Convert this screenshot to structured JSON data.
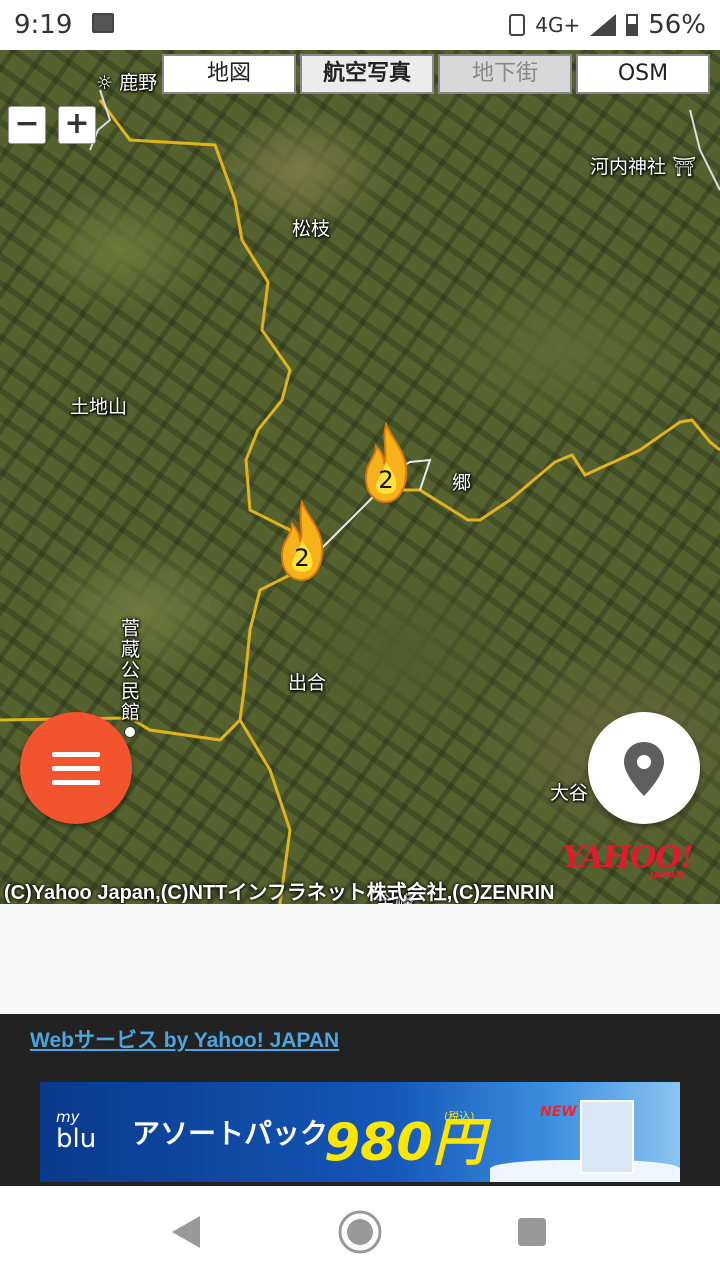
{
  "status_bar": {
    "time": "9:19",
    "network": "4G+",
    "battery": "56%"
  },
  "map": {
    "zoom_out_label": "−",
    "zoom_in_label": "+",
    "layer_tabs": [
      {
        "label": "地図",
        "state": "normal"
      },
      {
        "label": "航空写真",
        "state": "active"
      },
      {
        "label": "地下街",
        "state": "disabled"
      },
      {
        "label": "OSM",
        "state": "normal"
      }
    ],
    "labels": {
      "kanoya": "鹿野",
      "kawachi_shrine": "河内神社",
      "matsueda": "松枝",
      "tochiyama": "土地山",
      "go": "郷",
      "suganura_hall": "菅蔵公民館",
      "deai": "出合",
      "oya": "大谷",
      "partial_bottom": "金峰"
    },
    "clusters": [
      {
        "count": "2"
      },
      {
        "count": "2"
      }
    ],
    "copyright": "(C)Yahoo Japan,(C)NTTインフラネット株式会社,(C)ZENRIN",
    "logo_text": "YAHOO!",
    "logo_sub": "JAPAN"
  },
  "footer": {
    "service_link": "Webサービス by Yahoo! JAPAN",
    "ad": {
      "brand_small": "my",
      "brand": "blu",
      "title": "アソートパック",
      "price": "980円",
      "tax_note": "(税込)",
      "badge": "NEW"
    }
  },
  "colors": {
    "menu_fab": "#f2542d",
    "road": "#e0b21c",
    "link": "#4aa6e0"
  }
}
